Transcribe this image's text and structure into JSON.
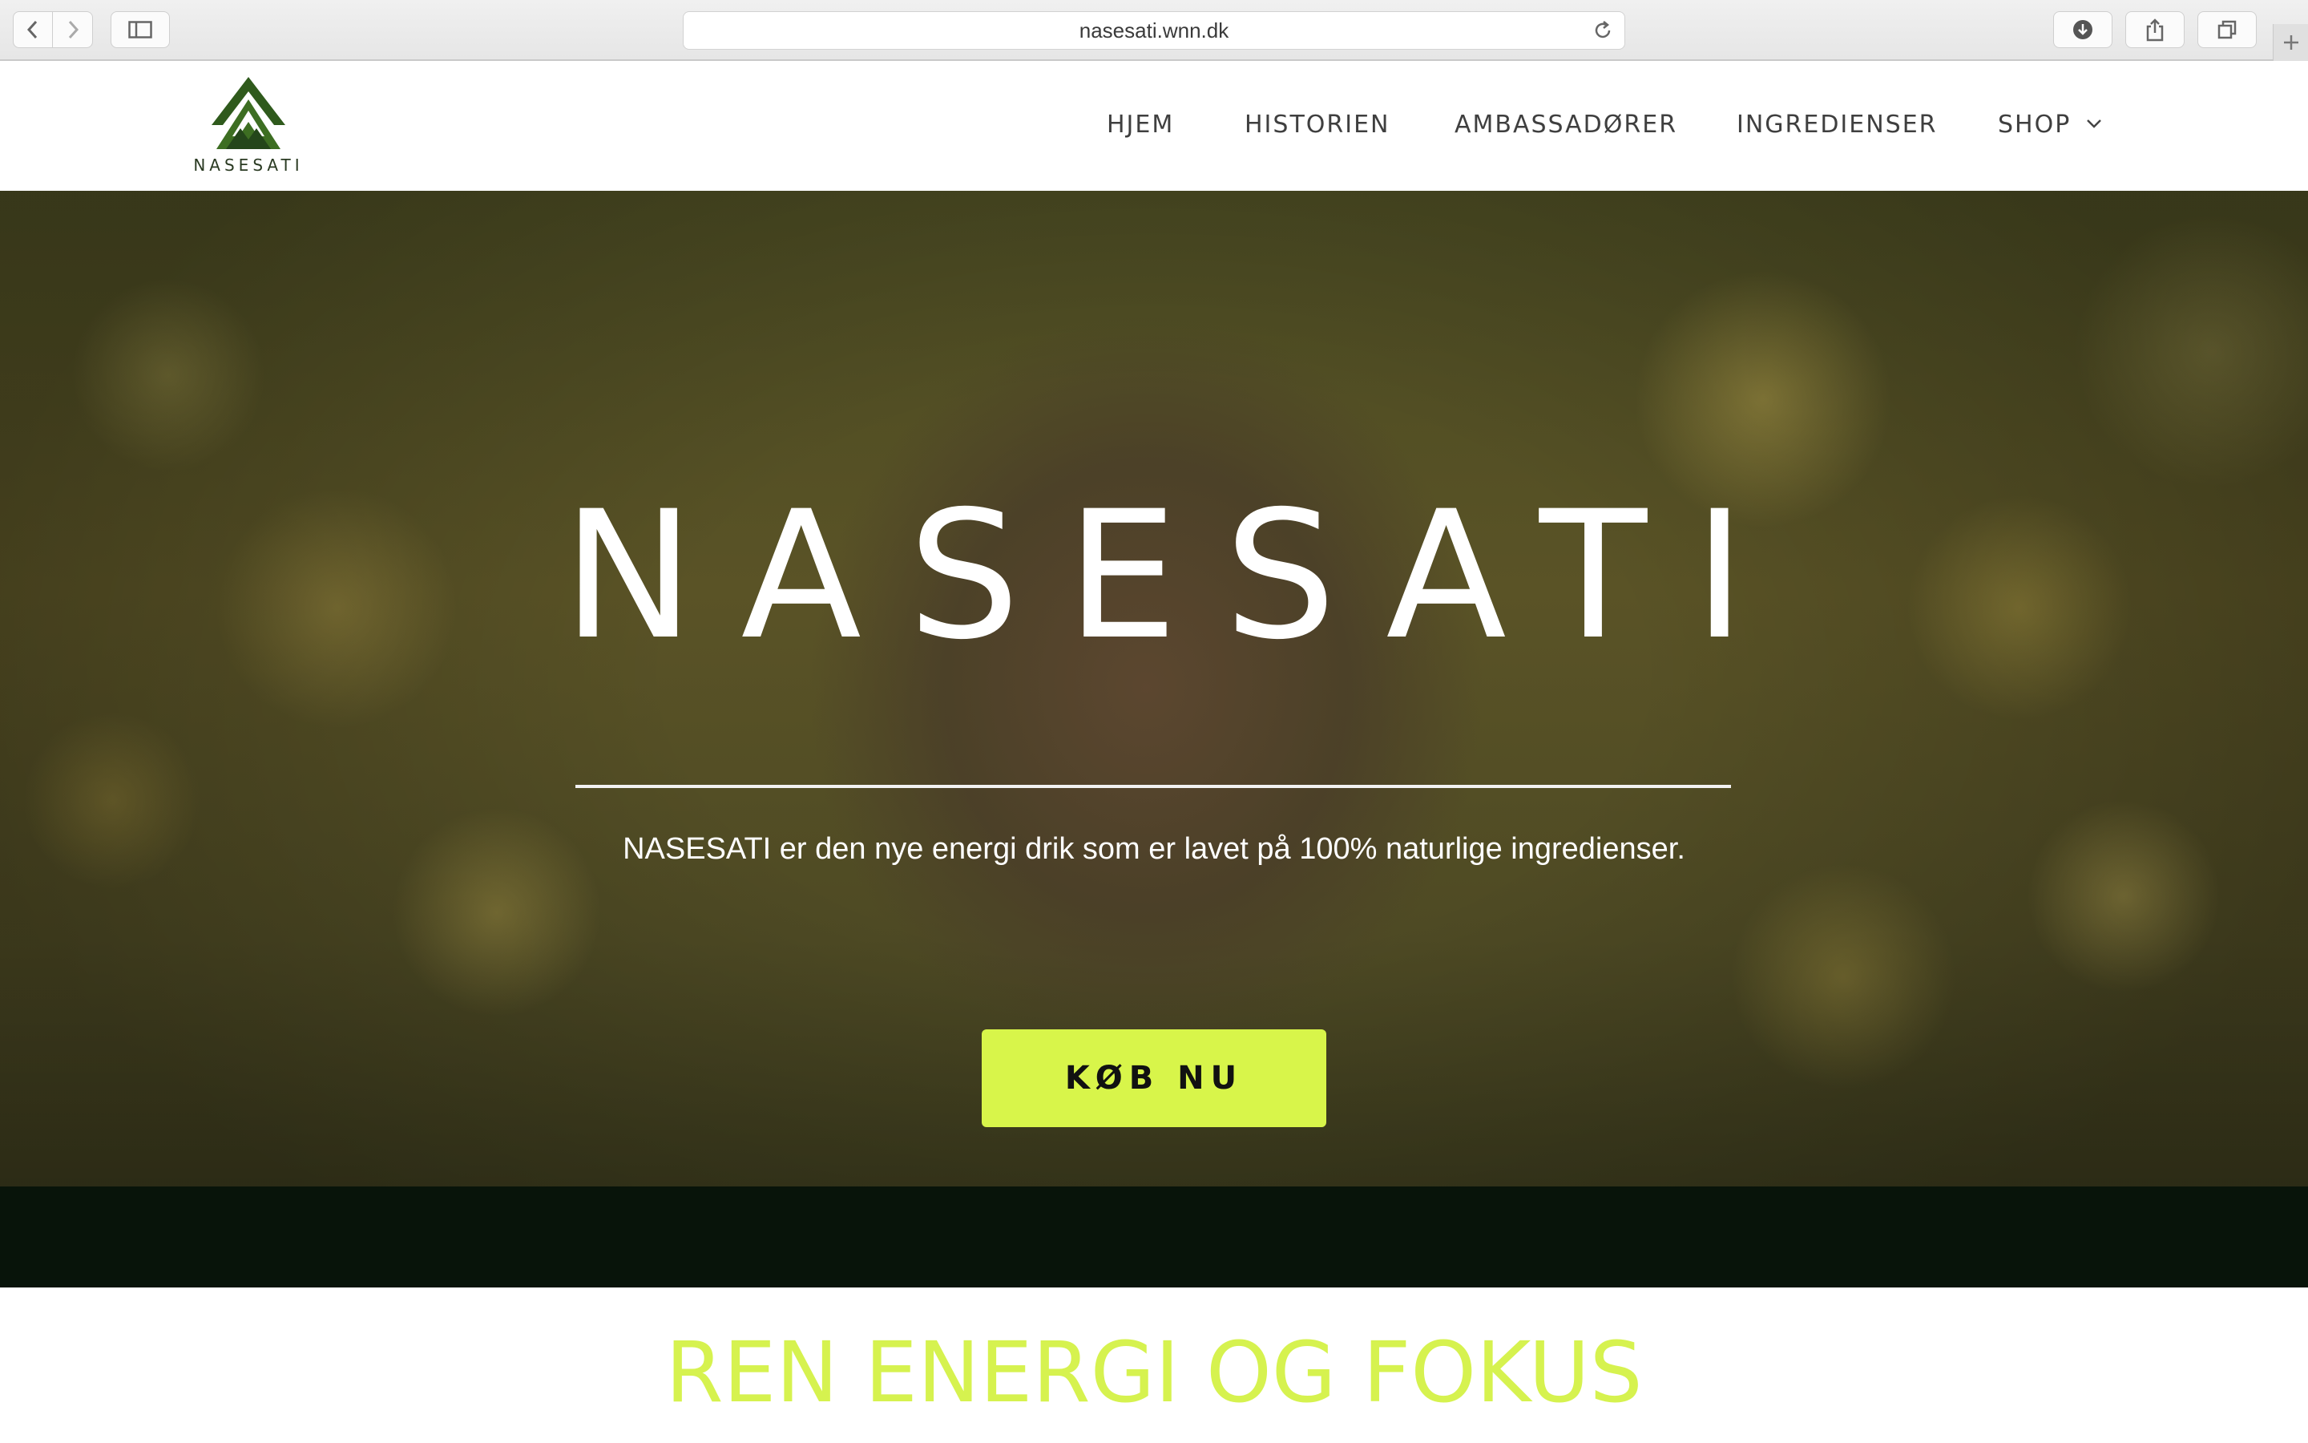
{
  "browser": {
    "url": "nasesati.wnn.dk"
  },
  "site": {
    "logo_text": "NASESATI",
    "nav": {
      "items": [
        {
          "label": "HJEM"
        },
        {
          "label": "HISTORIEN"
        },
        {
          "label": "AMBASSADØRER"
        },
        {
          "label": "INGREDIENSER"
        },
        {
          "label": "SHOP"
        }
      ]
    }
  },
  "hero": {
    "brand": "NASESATI",
    "tagline": "NASESATI er den nye energi drik som er lavet på 100% naturlige ingredienser.",
    "cta_label": "KØB NU"
  },
  "section": {
    "title": "REN ENERGI OG FOKUS"
  },
  "colors": {
    "accent": "#d8f54a",
    "dark_band": "#08140a",
    "logo_green": "#2f5a1c"
  },
  "icons": [
    "back-arrow-icon",
    "forward-arrow-icon",
    "sidebar-icon",
    "reload-icon",
    "download-icon",
    "share-icon",
    "tabs-icon",
    "plus-icon",
    "chevron-down-icon"
  ]
}
